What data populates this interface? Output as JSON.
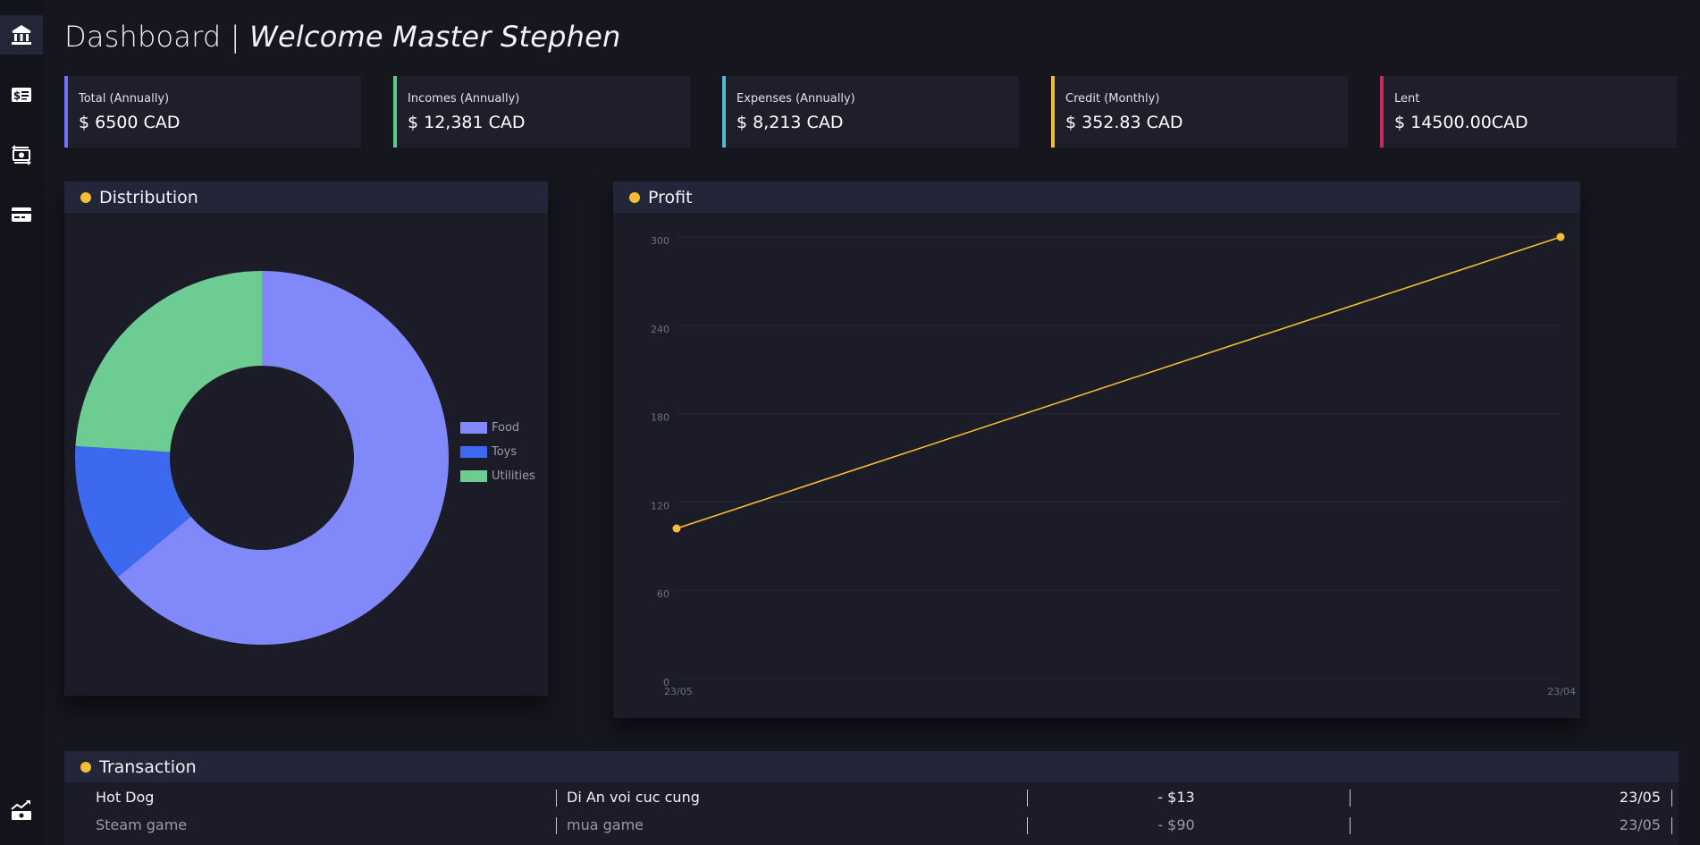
{
  "page": {
    "title_prefix": "Dashboard | ",
    "title_welcome": "Welcome Master Stephen"
  },
  "sidebar": {
    "items": [
      {
        "icon": "bank-icon",
        "active": true
      },
      {
        "icon": "money-card-icon",
        "active": false
      },
      {
        "icon": "money-exchange-icon",
        "active": false
      },
      {
        "icon": "credit-card-icon",
        "active": false
      },
      {
        "icon": "chart-money-icon",
        "active": false
      }
    ]
  },
  "stats": [
    {
      "label": "Total (Annually)",
      "value": "$ 6500 CAD",
      "color": "#6f74f5"
    },
    {
      "label": "Incomes (Annually)",
      "value": "$ 12,381 CAD",
      "color": "#5fca8a"
    },
    {
      "label": "Expenses (Annually)",
      "value": "$ 8,213 CAD",
      "color": "#53b9cf"
    },
    {
      "label": "Credit (Monthly)",
      "value": "$ 352.83 CAD",
      "color": "#f4bd35"
    },
    {
      "label": "Lent",
      "value": "$ 14500.00CAD",
      "color": "#c72b5c"
    }
  ],
  "distribution": {
    "title": "Distribution",
    "chart_data": {
      "type": "pie",
      "categories": [
        "Food",
        "Toys",
        "Utilities"
      ],
      "values": [
        64,
        12,
        24
      ],
      "colors": [
        "#8188f9",
        "#3d68f0",
        "#6ccc92"
      ]
    }
  },
  "profit": {
    "title": "Profit",
    "chart_data": {
      "type": "line",
      "x": [
        "23/05",
        "23/04"
      ],
      "series": [
        {
          "values": [
            102,
            300
          ],
          "color": "#f4bd35"
        }
      ],
      "yticks": [
        0,
        60,
        120,
        180,
        240,
        300
      ],
      "ylim": [
        0,
        300
      ],
      "grid": true
    }
  },
  "transaction": {
    "title": "Transaction",
    "rows": [
      {
        "name": "Hot Dog",
        "description": "Di An voi cuc cung",
        "amount": "- $13",
        "date": "23/05"
      },
      {
        "name": "Steam game",
        "description": "mua game",
        "amount": "- $90",
        "date": "23/05"
      }
    ]
  }
}
